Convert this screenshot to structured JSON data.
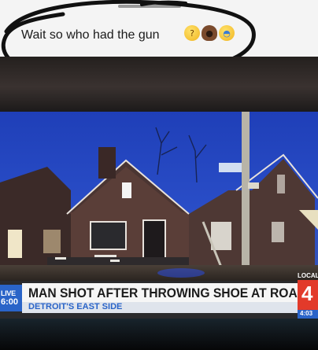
{
  "post": {
    "caption": "Wait so who had the gun",
    "emojis": [
      {
        "name": "thinking-face-icon",
        "glyph": "🤔"
      },
      {
        "name": "man-shrugging-icon",
        "glyph": "🤷"
      },
      {
        "name": "crying-laughing-icon",
        "glyph": "😭"
      }
    ]
  },
  "broadcast": {
    "live_tag": "LIVE",
    "time_left": "6:00",
    "headline": "MAN SHOT AFTER THROWING SHOE AT ROACH",
    "subheadline": "DETROIT'S EAST SIDE",
    "station_label": "LOCAL",
    "station_number": "4",
    "clock": "4:03"
  },
  "colors": {
    "accent_blue": "#2a64c8",
    "station_red": "#e23a2a",
    "scribble": "#111111"
  }
}
